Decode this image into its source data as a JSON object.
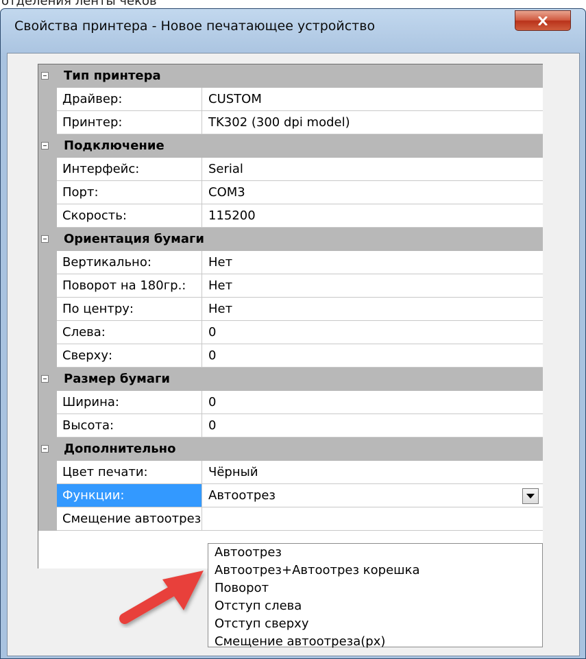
{
  "background": {
    "partial_text": "отделения ленты чеков"
  },
  "window": {
    "title": "Свойства принтера - Новое печатающее устройство",
    "close_button": "close-icon"
  },
  "property_grid": {
    "categories": [
      {
        "label": "Тип принтера",
        "rows": [
          {
            "name": "Драйвер:",
            "value": "CUSTOM"
          },
          {
            "name": "Принтер:",
            "value": "TK302 (300 dpi model)"
          }
        ]
      },
      {
        "label": "Подключение",
        "rows": [
          {
            "name": "Интерфейс:",
            "value": "Serial"
          },
          {
            "name": "Порт:",
            "value": "COM3"
          },
          {
            "name": "Скорость:",
            "value": "115200"
          }
        ]
      },
      {
        "label": "Ориентация бумаги",
        "rows": [
          {
            "name": "Вертикально:",
            "value": "Нет"
          },
          {
            "name": "Поворот на 180гр.:",
            "value": "Нет"
          },
          {
            "name": "По центру:",
            "value": "Нет"
          },
          {
            "name": "Слева:",
            "value": "0"
          },
          {
            "name": "Сверху:",
            "value": "0"
          }
        ]
      },
      {
        "label": "Размер бумаги",
        "rows": [
          {
            "name": "Ширина:",
            "value": "0"
          },
          {
            "name": "Высота:",
            "value": "0"
          }
        ]
      },
      {
        "label": "Дополнительно",
        "rows": [
          {
            "name": "Цвет печати:",
            "value": "Чёрный"
          },
          {
            "name": "Функции:",
            "value": "Автоотрез",
            "selected": true
          },
          {
            "name": "Смещение автоотреза(px)",
            "value": ""
          }
        ]
      }
    ]
  },
  "dropdown": {
    "options": [
      "Автоотрез",
      "Автоотрез+Автоотрез корешка",
      "Поворот",
      "Отступ слева",
      "Отступ сверху",
      "Смещение автоотреза(px)"
    ]
  },
  "colors": {
    "selection": "#3399ff",
    "category_bg": "#b8b8b8",
    "arrow": "#e8413a"
  }
}
